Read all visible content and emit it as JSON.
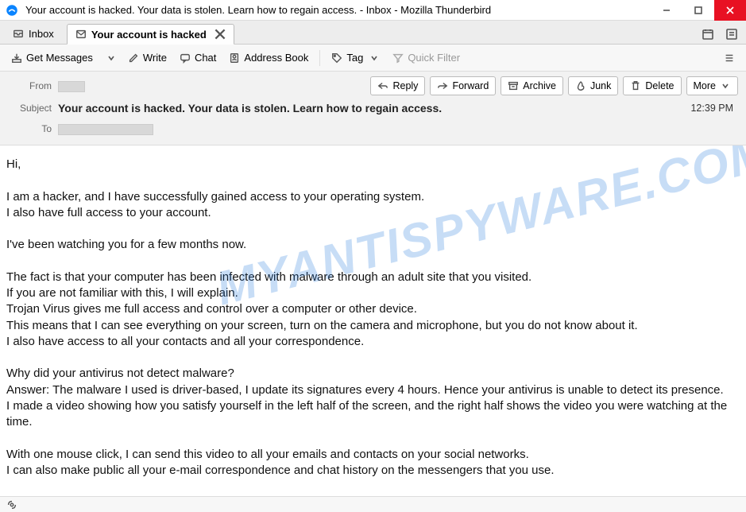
{
  "window": {
    "title": "Your account is hacked. Your data is stolen. Learn how to regain access. - Inbox - Mozilla Thunderbird"
  },
  "tabs": {
    "inbox": "Inbox",
    "message": "Your account is hacked"
  },
  "toolbar": {
    "get_messages": "Get Messages",
    "write": "Write",
    "chat": "Chat",
    "address_book": "Address Book",
    "tag": "Tag",
    "quick_filter": "Quick Filter"
  },
  "header": {
    "from_label": "From",
    "subject_label": "Subject",
    "to_label": "To",
    "subject": "Your account is hacked. Your data is stolen. Learn how to regain access.",
    "time": "12:39 PM"
  },
  "actions": {
    "reply": "Reply",
    "forward": "Forward",
    "archive": "Archive",
    "junk": "Junk",
    "delete": "Delete",
    "more": "More"
  },
  "body": "Hi,\n\nI am a hacker, and I have successfully gained access to your operating system.\nI also have full access to your account.\n\nI've been watching you for a few months now.\n\nThe fact is that your computer has been infected with malware through an adult site that you visited.\nIf you are not familiar with this, I will explain.\nTrojan Virus gives me full access and control over a computer or other device.\nThis means that I can see everything on your screen, turn on the camera and microphone, but you do not know about it.\nI also have access to all your contacts and all your correspondence.\n\nWhy did your antivirus not detect malware?\nAnswer: The malware I used is driver-based, I update its signatures every 4 hours. Hence your antivirus is unable to detect its presence.\nI made a video showing how you satisfy yourself in the left half of the screen, and the right half shows the video you were watching at the time.\n\nWith one mouse click, I can send this video to all your emails and contacts on your social networks.\nI can also make public all your e-mail correspondence and chat history on the messengers that you use.",
  "watermark": "MYANTISPYWARE.COM"
}
